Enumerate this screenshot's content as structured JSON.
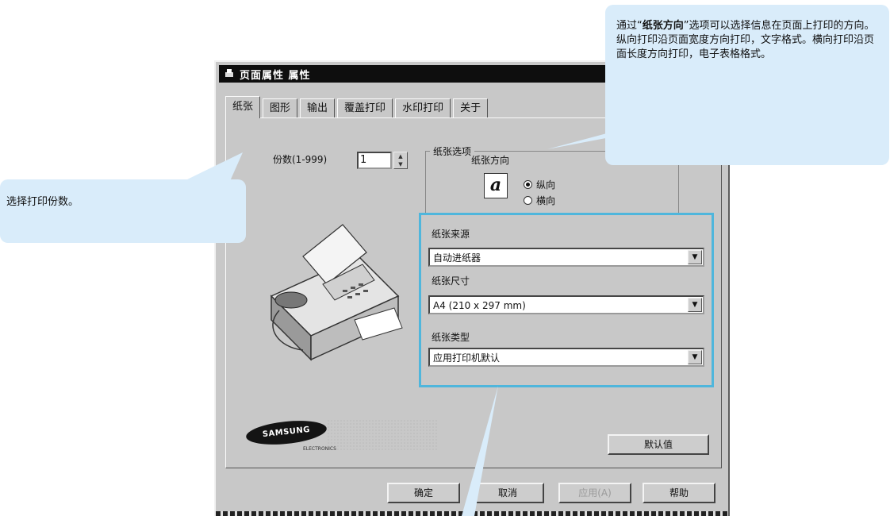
{
  "dialog": {
    "title": "页面属性 属性",
    "tabs": [
      "纸张",
      "图形",
      "输出",
      "覆盖打印",
      "水印打印",
      "关于"
    ],
    "copies": {
      "label": "份数(1-999)",
      "value": "1"
    },
    "paper_options": {
      "group_title": "纸张选项",
      "orientation_label": "纸张方向",
      "icon_glyph": "a",
      "portrait": "纵向",
      "landscape": "横向",
      "selected": "纵向"
    },
    "paper_source": {
      "label": "纸张来源",
      "value": "自动进纸器"
    },
    "paper_size": {
      "label": "纸张尺寸",
      "value": "A4 (210 x 297 mm)"
    },
    "paper_type": {
      "label": "纸张类型",
      "value": "应用打印机默认"
    },
    "logo": {
      "text": "SAMSUNG",
      "sub": "ELECTRONICS"
    },
    "buttons": {
      "defaults": "默认值",
      "ok": "确定",
      "cancel": "取消",
      "apply": "应用(A)",
      "help": "帮助"
    }
  },
  "callouts": {
    "copies": "选择打印份数。",
    "orientation": {
      "prefix": "通过“",
      "highlight": "纸张方向",
      "suffix": "”选项可以选择信息在页面上打印的方向。纵向打印沿页面宽度方向打印，文字格式。横向打印沿页面长度方向打印，电子表格格式。"
    }
  },
  "colors": {
    "callout_bg": "#d9ecfa",
    "highlight_border": "#4fb6dc",
    "dialog_bg": "#c8c8c8",
    "titlebar_bg": "#0e0e0e"
  }
}
